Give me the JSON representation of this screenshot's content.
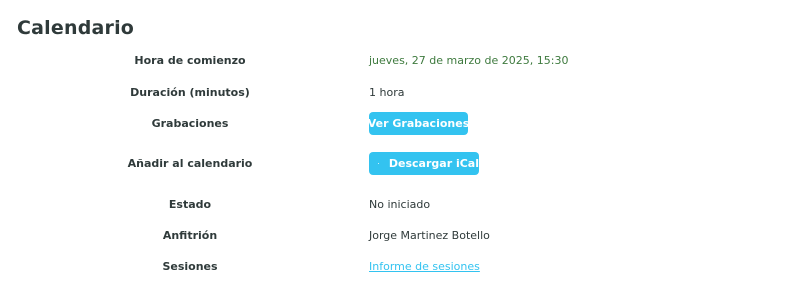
{
  "title": "Calendario",
  "rows": {
    "start_time": {
      "label": "Hora de comienzo",
      "value": "jueves, 27 de marzo de 2025, 15:30"
    },
    "duration": {
      "label": "Duración (minutos)",
      "value": "1 hora"
    },
    "recordings": {
      "label": "Grabaciones",
      "button": "Ver Grabaciones"
    },
    "add_calendar": {
      "label": "Añadir al calendario",
      "button": "Descargar iCal",
      "icon": "calendar-icon"
    },
    "status": {
      "label": "Estado",
      "value": "No iniciado"
    },
    "host": {
      "label": "Anfitrión",
      "value": "Jorge Martinez Botello"
    },
    "sessions": {
      "label": "Sesiones",
      "link": "Informe de sesiones"
    }
  },
  "colors": {
    "accent": "#33c3f0",
    "text": "#2f3a3a",
    "date_text": "#3e7a3e"
  }
}
